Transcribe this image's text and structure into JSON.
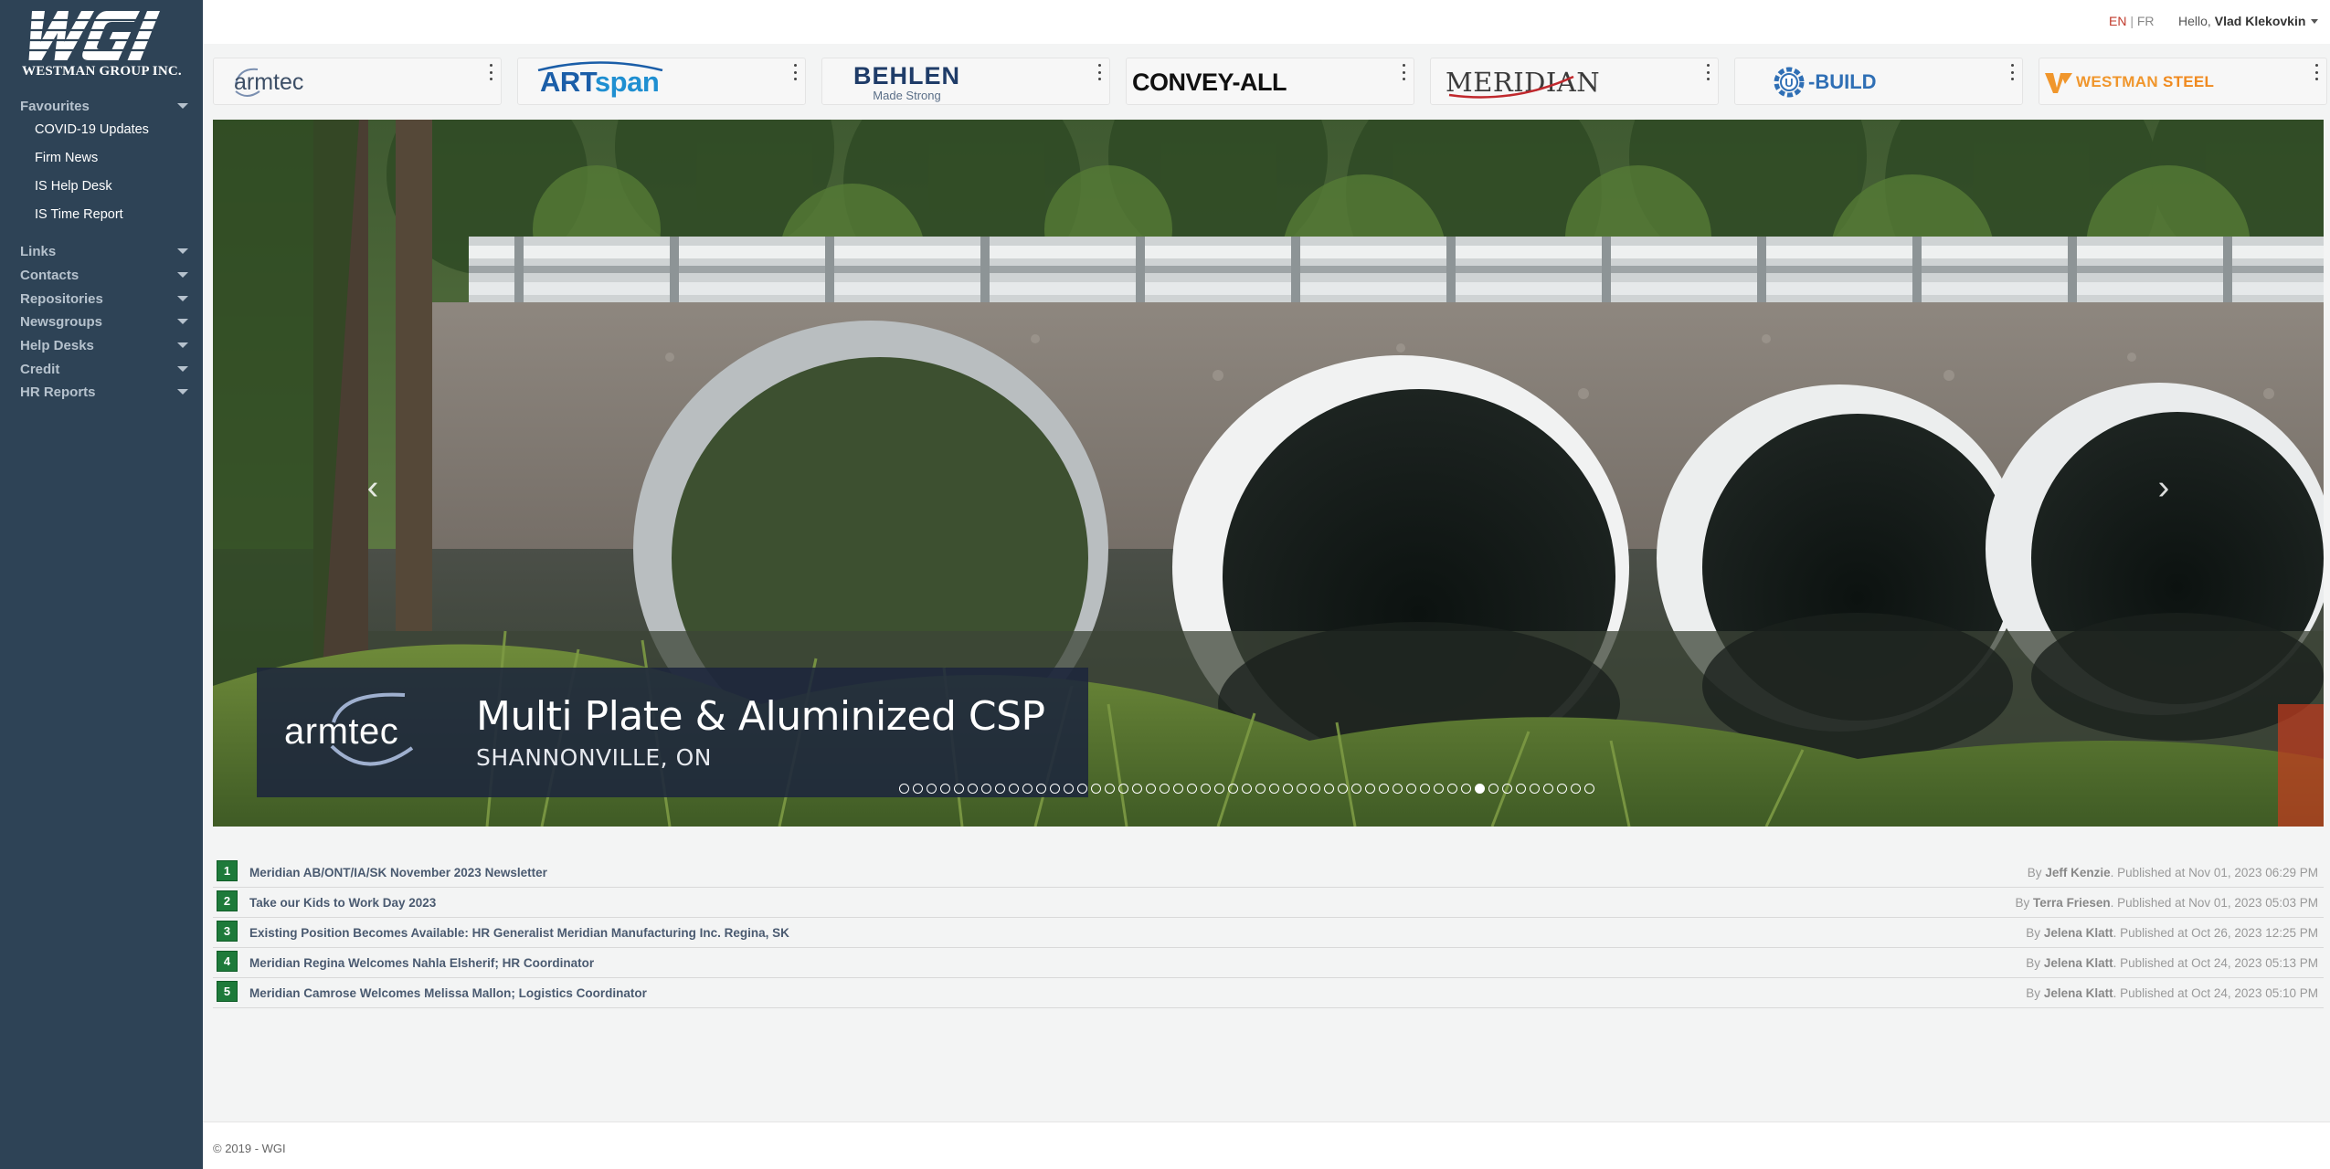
{
  "sidebar": {
    "company": "WESTMAN GROUP INC.",
    "favourites_label": "Favourites",
    "favourites": [
      "COVID-19 Updates",
      "Firm News",
      "IS Help Desk",
      "IS Time Report"
    ],
    "sections": [
      "Links",
      "Contacts",
      "Repositories",
      "Newsgroups",
      "Help Desks",
      "Credit",
      "HR Reports"
    ]
  },
  "topbar": {
    "lang_en": "EN",
    "lang_sep": " | ",
    "lang_fr": "FR",
    "greeting": "Hello,",
    "user_name": "Vlad Klekovkin"
  },
  "brands": {
    "armtec": "armtec",
    "artspan_a": "ART",
    "artspan_b": "span",
    "behlen": "BEHLEN",
    "behlen_tag": "Made Strong",
    "convey": "CONVEY-ALL",
    "meridian": "MERIDIAN",
    "ubuild": "-BUILD",
    "westman_a": "WESTMAN ",
    "westman_b": "STEEL"
  },
  "carousel": {
    "caption_logo": "armtec",
    "caption_title": "Multi Plate & Aluminized CSP",
    "caption_subtitle": "SHANNONVILLE, ON",
    "slide_count": 51,
    "active_slide": 43
  },
  "news": [
    {
      "num": "1",
      "title": "Meridian AB/ONT/IA/SK November 2023 Newsletter",
      "by": "By ",
      "author": "Jeff Kenzie",
      "published": ".  Published at Nov 01, 2023 06:29 PM"
    },
    {
      "num": "2",
      "title": "Take our Kids to Work Day 2023",
      "by": "By ",
      "author": "Terra Friesen",
      "published": ".  Published at Nov 01, 2023 05:03 PM"
    },
    {
      "num": "3",
      "title": "Existing Position Becomes Available: HR Generalist Meridian Manufacturing Inc. Regina, SK",
      "by": "By ",
      "author": "Jelena Klatt",
      "published": ".  Published at Oct 26, 2023 12:25 PM"
    },
    {
      "num": "4",
      "title": "Meridian Regina Welcomes Nahla Elsherif; HR Coordinator",
      "by": "By ",
      "author": "Jelena Klatt",
      "published": ".  Published at Oct 24, 2023 05:13 PM"
    },
    {
      "num": "5",
      "title": "Meridian Camrose Welcomes Melissa Mallon; Logistics Coordinator",
      "by": "By ",
      "author": "Jelena Klatt",
      "published": ".  Published at Oct 24, 2023 05:10 PM"
    }
  ],
  "footer": {
    "copyright": "© 2019 - WGI"
  },
  "colors": {
    "sidebar": "#2e4356",
    "news_badge": "#1e7a3a",
    "lang_active": "#c0392b"
  }
}
